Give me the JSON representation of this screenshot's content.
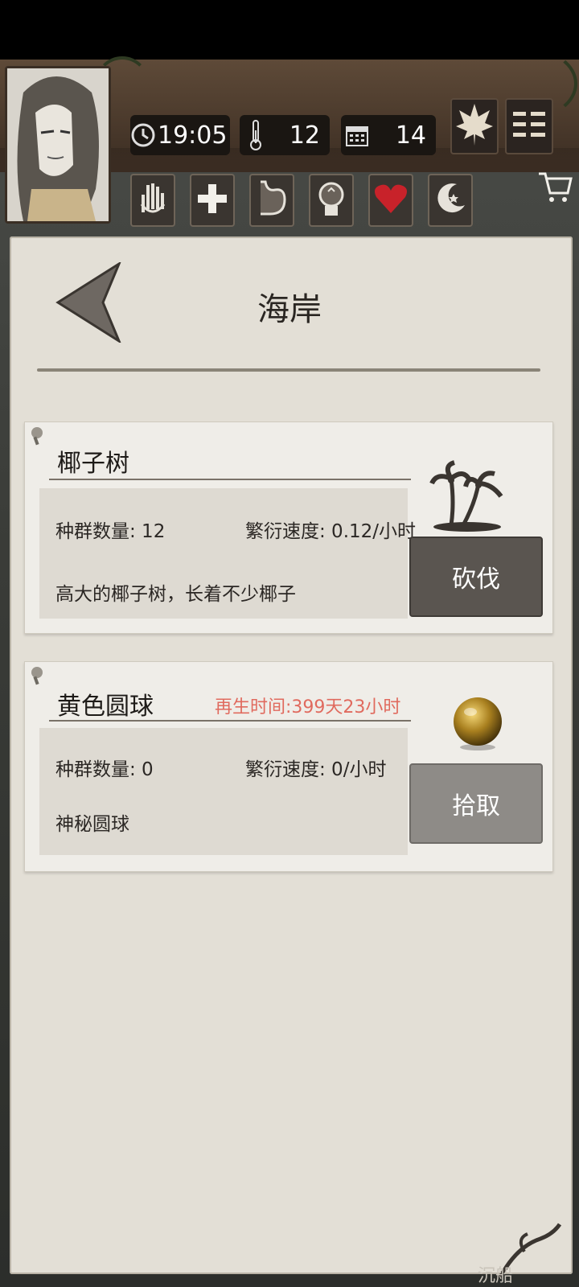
{
  "hud": {
    "time": "19:05",
    "temperature": "12",
    "day": "14",
    "icons": {
      "clock": "clock-icon",
      "thermometer": "thermometer-icon",
      "calendar": "calendar-icon",
      "leaf": "maple-leaf-icon",
      "menu": "menu-icon",
      "cart": "cart-icon"
    },
    "stats": [
      "hand-icon",
      "health-cross-icon",
      "stomach-icon",
      "mind-icon",
      "heart-icon",
      "moon-icon"
    ],
    "colors": {
      "heart": "#c8222a",
      "bar_bg": "#1a1612",
      "wood": "#4b3a2c"
    }
  },
  "page": {
    "title": "海岸"
  },
  "resources": [
    {
      "name": "椰子树",
      "population_label": "种群数量: 12",
      "growth_label": "繁衍速度: 0.12/小时",
      "description": "高大的椰子树，长着不少椰子",
      "action": "砍伐",
      "icon": "palm-tree-icon"
    },
    {
      "name": "黄色圆球",
      "respawn": "再生时间:399天23小时",
      "population_label": "种群数量: 0",
      "growth_label": "繁衍速度: 0/小时",
      "description": "神秘圆球",
      "action": "拾取",
      "icon": "yellow-orb-icon"
    }
  ],
  "footer": {
    "watermark": "沉船"
  }
}
